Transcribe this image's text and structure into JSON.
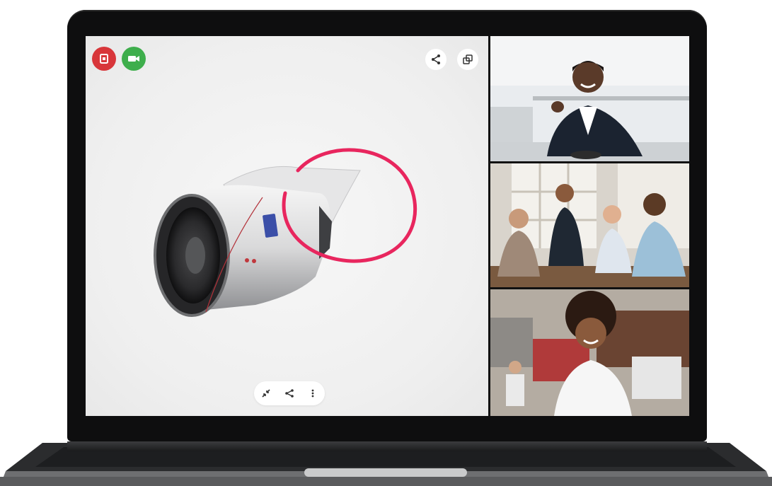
{
  "app": {
    "title": ""
  },
  "colors": {
    "end_call": "#d8363a",
    "camera": "#3eae4c",
    "annotation_circle": "#e8265e",
    "stage_background": "#f1f1f1"
  },
  "controls": {
    "end_call": {
      "icon": "end-call-icon"
    },
    "camera": {
      "icon": "video-camera-icon"
    },
    "share_top": {
      "icon": "share-icon"
    },
    "popout": {
      "icon": "popout-window-icon"
    }
  },
  "bottom_toolbar": {
    "items": [
      {
        "icon": "collapse-arrows-icon"
      },
      {
        "icon": "share-icon"
      },
      {
        "icon": "more-vertical-icon"
      }
    ]
  },
  "participants": [
    {
      "tile": "presenter-in-office"
    },
    {
      "tile": "group-meeting-room"
    },
    {
      "tile": "participant-in-studio"
    }
  ]
}
